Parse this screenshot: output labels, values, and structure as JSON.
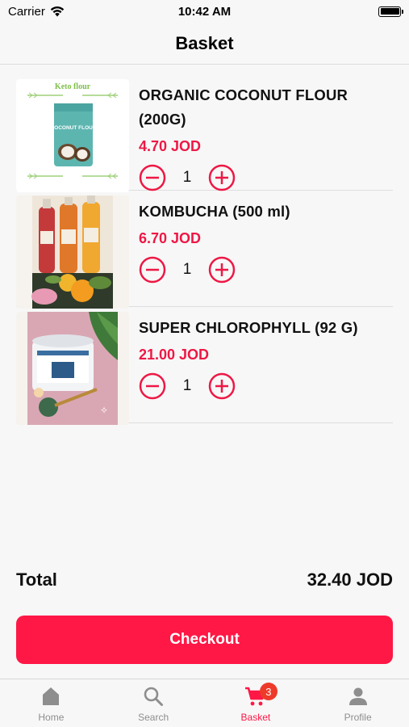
{
  "status_bar": {
    "carrier": "Carrier",
    "time": "10:42 AM"
  },
  "header": {
    "title": "Basket"
  },
  "items": [
    {
      "name": "ORGANIC COCONUT FLOUR (200G)",
      "price": "4.70 JOD",
      "quantity": "1",
      "image_text": "Keto flour",
      "package_text": "COCONUT FLOUR"
    },
    {
      "name": "KOMBUCHA (500 ml)",
      "price": "6.70 JOD",
      "quantity": "1"
    },
    {
      "name": "SUPER CHLOROPHYLL (92 G)",
      "price": "21.00 JOD",
      "quantity": "1"
    }
  ],
  "total": {
    "label": "Total",
    "value": "32.40 JOD"
  },
  "checkout": {
    "label": "Checkout"
  },
  "tabs": [
    {
      "label": "Home",
      "icon": "home-icon"
    },
    {
      "label": "Search",
      "icon": "search-icon"
    },
    {
      "label": "Basket",
      "icon": "cart-icon",
      "badge": "3",
      "active": true
    },
    {
      "label": "Profile",
      "icon": "profile-icon"
    }
  ],
  "colors": {
    "accent": "#ff1745",
    "price": "#ee1845",
    "badge": "#ee3a2a",
    "inactive": "#8e8e8e"
  }
}
